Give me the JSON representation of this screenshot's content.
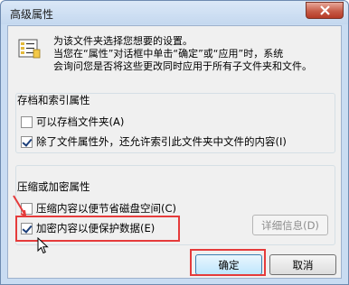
{
  "window": {
    "title": "高级属性"
  },
  "info": {
    "line1": "为该文件夹选择您想要的设置。",
    "line2": "当您在“属性”对话框中单击“确定”或“应用”时，系统",
    "line3": "会询问您是否将这些更改同时应用于所有子文件夹和文件。"
  },
  "archive_group": {
    "title": "存档和索引属性",
    "archive_label": "可以存档文件夹(A)",
    "archive_checked": false,
    "index_label": "除了文件属性外，还允许索引此文件夹中文件的内容(I)",
    "index_checked": true
  },
  "compress_group": {
    "title": "压缩或加密属性",
    "compress_label": "压缩内容以便节省磁盘空间(C)",
    "compress_checked": false,
    "encrypt_label": "加密内容以便保护数据(E)",
    "encrypt_checked": true,
    "details_label": "详细信息(D)"
  },
  "buttons": {
    "ok": "确定",
    "cancel": "取消"
  },
  "colors": {
    "highlight": "#e53b3b",
    "close": "#c75c48"
  }
}
